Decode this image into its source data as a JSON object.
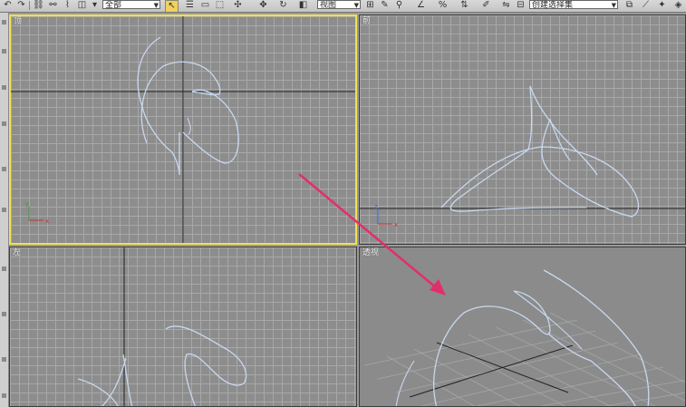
{
  "toolbar": {
    "selection_set_value": "全部",
    "view_dropdown_value": "视图",
    "named_selection_value": "创建选择集"
  },
  "viewports": {
    "top": {
      "label": "顶"
    },
    "front": {
      "label": "前"
    },
    "left": {
      "label": "左"
    },
    "perspective": {
      "label": "透视"
    }
  },
  "axis": {
    "x": "x",
    "y": "y",
    "z": "z"
  },
  "colors": {
    "active_border": "#f0e050",
    "grid_line": "#a8a8a8",
    "viewport_bg": "#8d8d8d",
    "spline": "#c8d8f0",
    "annotation_arrow": "#e0306a"
  },
  "icons": {
    "select": "cursor-arrow-icon",
    "move": "move-cross-icon",
    "rotate": "rotate-icon",
    "scale": "scale-icon"
  }
}
